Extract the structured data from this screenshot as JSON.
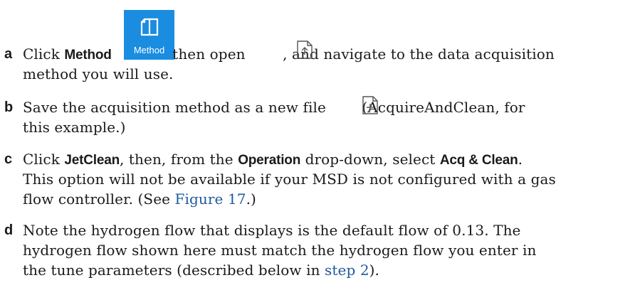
{
  "steps": [
    {
      "letter": "a",
      "lines": [
        {
          "t1": "Click ",
          "b1": "Method",
          "t2": " then open ",
          "t3": ", and navigate to the data acquisition"
        },
        {
          "t1": "method you will use."
        }
      ],
      "tile_label": "Method",
      "icons": [
        "method-icon",
        "open-file-icon"
      ]
    },
    {
      "letter": "b",
      "lines": [
        {
          "t1": "Save the acquisition method as a new file ",
          "t2": "(AcquireAndClean, for"
        },
        {
          "t1": "this example.)"
        }
      ],
      "icons": [
        "new-file-icon"
      ]
    },
    {
      "letter": "c",
      "lines": [
        {
          "t1": "Click ",
          "b1": "JetClean",
          "t2": ", then, from the ",
          "b2": "Operation",
          "t3": " drop-down, select ",
          "b3": "Acq & Clean",
          "t4": "."
        },
        {
          "t1": "This option will not be available if your MSD is not configured with a gas"
        },
        {
          "t1": "flow controller. (See ",
          "link": "Figure 17",
          "t2": ".)"
        }
      ]
    },
    {
      "letter": "d",
      "lines": [
        {
          "t1": "Note the hydrogen flow that displays is the default flow of 0.13. The"
        },
        {
          "t1": "hydrogen flow shown here must match the hydrogen flow you enter in"
        },
        {
          "t1": "the tune parameters (described below in ",
          "link": "step 2",
          "t2": ")."
        }
      ]
    }
  ]
}
